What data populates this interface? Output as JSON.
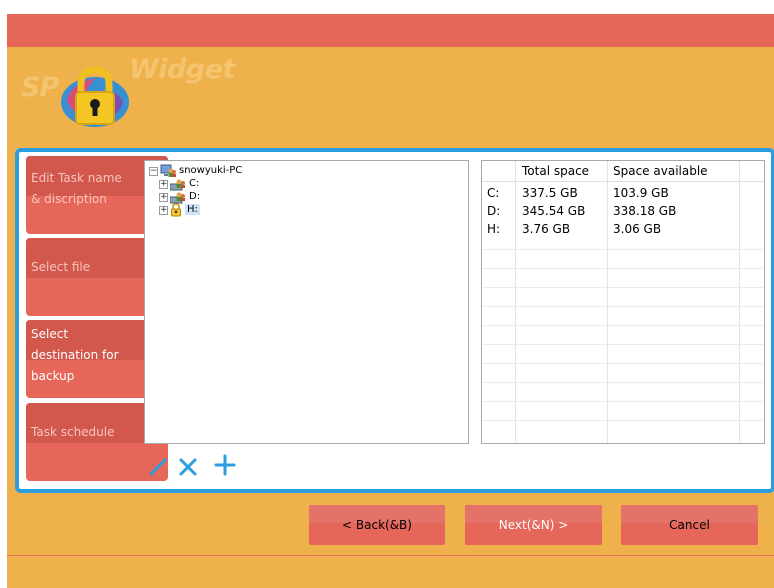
{
  "logo": {
    "text_left": "SP",
    "text_right": "Widget",
    "icon": "padlock-icon"
  },
  "steps": [
    {
      "label": "Edit Task name\n& discription",
      "active": false
    },
    {
      "label": "Select file",
      "active": false
    },
    {
      "label": "Select\ndestination for\nbackup",
      "active": true
    },
    {
      "label": "Task schedule",
      "active": false
    }
  ],
  "tree": {
    "root": {
      "label": "snowyuki-PC",
      "expander": "−",
      "icon": "computer-users-icon"
    },
    "children": [
      {
        "label": "C:",
        "expander": "+",
        "icon": "drive-users-icon"
      },
      {
        "label": "D:",
        "expander": "+",
        "icon": "drive-users-icon"
      },
      {
        "label": "H:",
        "expander": "+",
        "icon": "lock-drive-icon",
        "selected": true
      }
    ]
  },
  "drive_table": {
    "columns": [
      "",
      "Total space",
      "Space available"
    ],
    "rows": [
      {
        "drive": "C:",
        "total": "337.5 GB",
        "available": "103.9 GB"
      },
      {
        "drive": "D:",
        "total": "345.54 GB",
        "available": "338.18 GB"
      },
      {
        "drive": "H:",
        "total": "3.76 GB",
        "available": "3.06 GB"
      }
    ]
  },
  "toolbar": {
    "edit_icon": "pencil-icon",
    "delete_icon": "x-icon",
    "add_icon": "plus-icon"
  },
  "buttons": {
    "back": "< Back(&B)",
    "next": "Next(&N) >",
    "cancel": "Cancel"
  },
  "colors": {
    "accent_blue": "#2a9ee0",
    "orange": "#efb14c",
    "coral": "#e6665a"
  }
}
